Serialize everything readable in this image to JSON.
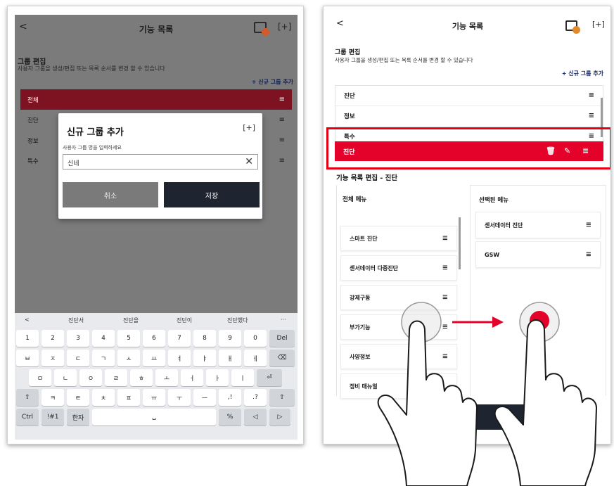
{
  "left": {
    "header": {
      "back": "<",
      "title": "기능 목록"
    },
    "section": {
      "title": "그룹 편집",
      "desc": "사용자 그룹을 생성/편집 또는 목록 순서를 변경 할 수 있습니다"
    },
    "add_link": "+ 신규 그룹 추가",
    "rows": [
      "전체",
      "진단",
      "정보",
      "특수"
    ],
    "dialog": {
      "title": "신규 그룹 추가",
      "hint": "사용자 그룹 명을 입력하세요",
      "input_value": "신네",
      "cancel": "취소",
      "save": "저장"
    },
    "keyboard": {
      "suggestions": [
        "<",
        "진단서",
        "진단을",
        "진단이",
        "진단했다",
        "···"
      ],
      "row1": [
        "1",
        "2",
        "3",
        "4",
        "5",
        "6",
        "7",
        "8",
        "9",
        "0",
        "Del"
      ],
      "row2": [
        "ㅂ",
        "ㅈ",
        "ㄷ",
        "ㄱ",
        "ㅅ",
        "ㅛ",
        "ㅕ",
        "ㅑ",
        "ㅐ",
        "ㅔ",
        "⌫"
      ],
      "row3": [
        "ㅁ",
        "ㄴ",
        "ㅇ",
        "ㄹ",
        "ㅎ",
        "ㅗ",
        "ㅓ",
        "ㅏ",
        "ㅣ",
        "⏎"
      ],
      "row4": [
        "⇧",
        "ㅋ",
        "ㅌ",
        "ㅊ",
        "ㅍ",
        "ㅠ",
        "ㅜ",
        "ㅡ",
        ",!",
        ".?",
        "⇧"
      ],
      "row5": [
        "Ctrl",
        "!#1",
        "한자",
        "␣",
        "%",
        "◁",
        "▷"
      ]
    }
  },
  "right": {
    "header": {
      "back": "<",
      "title": "기능 목록"
    },
    "section": {
      "title": "그룹 편집",
      "desc": "사용자 그룹을 생성/편집 또는 목록 순서를 변경 할 수 있습니다"
    },
    "add_link": "+ 신규 그룹 추가",
    "rows": [
      "진단",
      "정보",
      "특수"
    ],
    "selected_row": "진단",
    "edit_title": "기능 목록 편집 - 진단",
    "all_menu": {
      "heading": "전체 메뉴",
      "items": [
        "스마트 진단",
        "센서데이터 다중진단",
        "강제구동",
        "부가기능",
        "사양정보",
        "정비 매뉴얼"
      ]
    },
    "selected_menu": {
      "heading": "선택된 메뉴",
      "items": [
        "센서데이터 진단",
        "GSW"
      ]
    }
  },
  "colors": {
    "accent_red": "#e4022a",
    "dark_button": "#1e2530",
    "add_link": "#0e1f5b"
  }
}
